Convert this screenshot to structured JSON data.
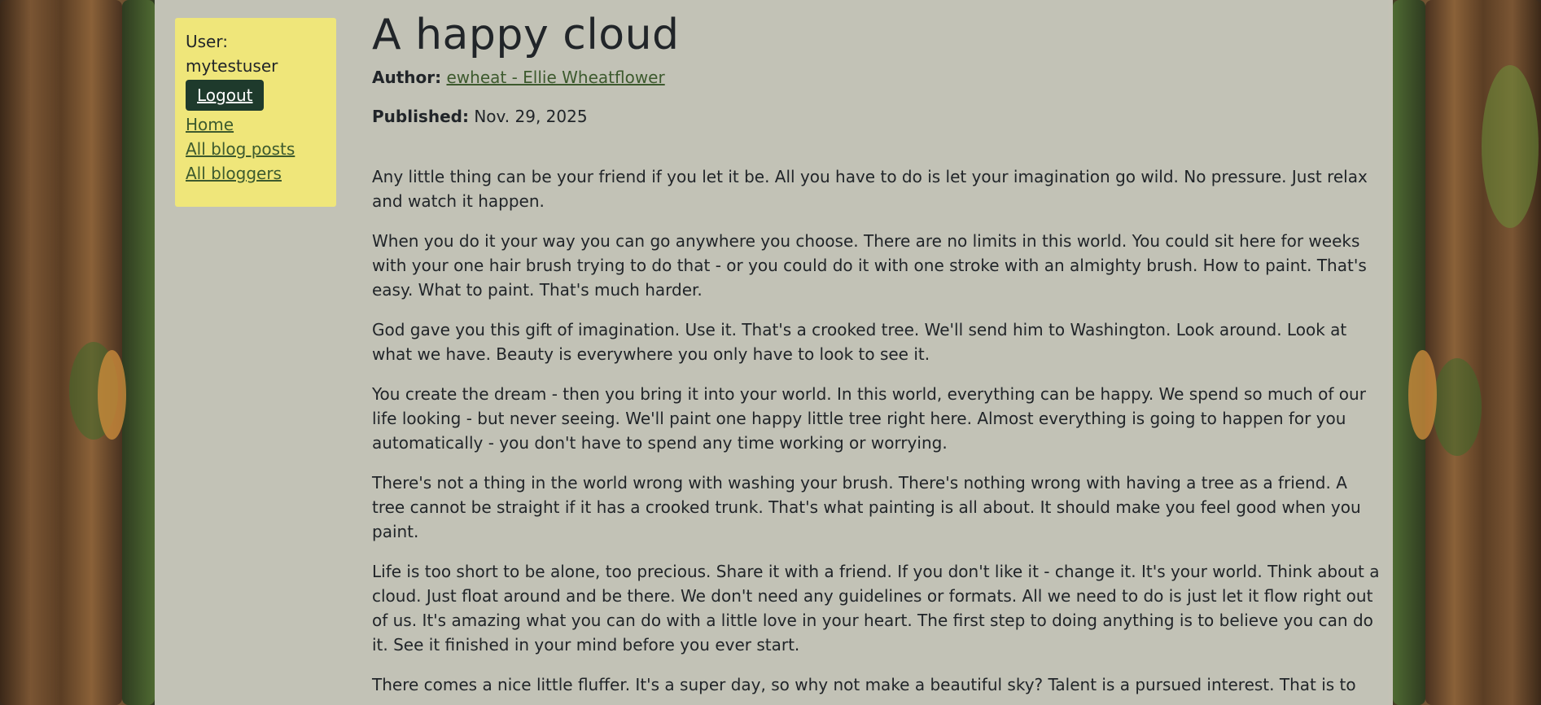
{
  "sidebar": {
    "user_label": "User:",
    "username": "mytestuser",
    "logout_label": "Logout",
    "links": [
      {
        "label": "Home"
      },
      {
        "label": "All blog posts"
      },
      {
        "label": "All bloggers"
      }
    ]
  },
  "post": {
    "title": "A happy cloud",
    "author_label": "Author:",
    "author_link": "ewheat - Ellie Wheatflower",
    "published_label": "Published:",
    "published_date": "Nov. 29, 2025",
    "paragraphs": [
      "Any little thing can be your friend if you let it be. All you have to do is let your imagination go wild. No pressure. Just relax and watch it happen.",
      "When you do it your way you can go anywhere you choose. There are no limits in this world. You could sit here for weeks with your one hair brush trying to do that - or you could do it with one stroke with an almighty brush. How to paint. That's easy. What to paint. That's much harder.",
      "God gave you this gift of imagination. Use it. That's a crooked tree. We'll send him to Washington. Look around. Look at what we have. Beauty is everywhere you only have to look to see it.",
      "You create the dream - then you bring it into your world. In this world, everything can be happy. We spend so much of our life looking - but never seeing. We'll paint one happy little tree right here. Almost everything is going to happen for you automatically - you don't have to spend any time working or worrying.",
      "There's not a thing in the world wrong with washing your brush. There's nothing wrong with having a tree as a friend. A tree cannot be straight if it has a crooked trunk. That's what painting is all about. It should make you feel good when you paint.",
      "Life is too short to be alone, too precious. Share it with a friend. If you don't like it - change it. It's your world. Think about a cloud. Just float around and be there. We don't need any guidelines or formats. All we need to do is just let it flow right out of us. It's amazing what you can do with a little love in your heart. The first step to doing anything is to believe you can do it. See it finished in your mind before you ever start.",
      "There comes a nice little fluffer. It's a super day, so why not make a beautiful sky? Talent is a pursued interest. That is to"
    ]
  },
  "colors": {
    "sidebar_bg": "#efe67a",
    "logout_bg": "#1e3a2c",
    "link_color": "#3d5a2e",
    "panel_bg": "rgba(236,232,224,0.78)"
  },
  "background": "forest-trees-image"
}
